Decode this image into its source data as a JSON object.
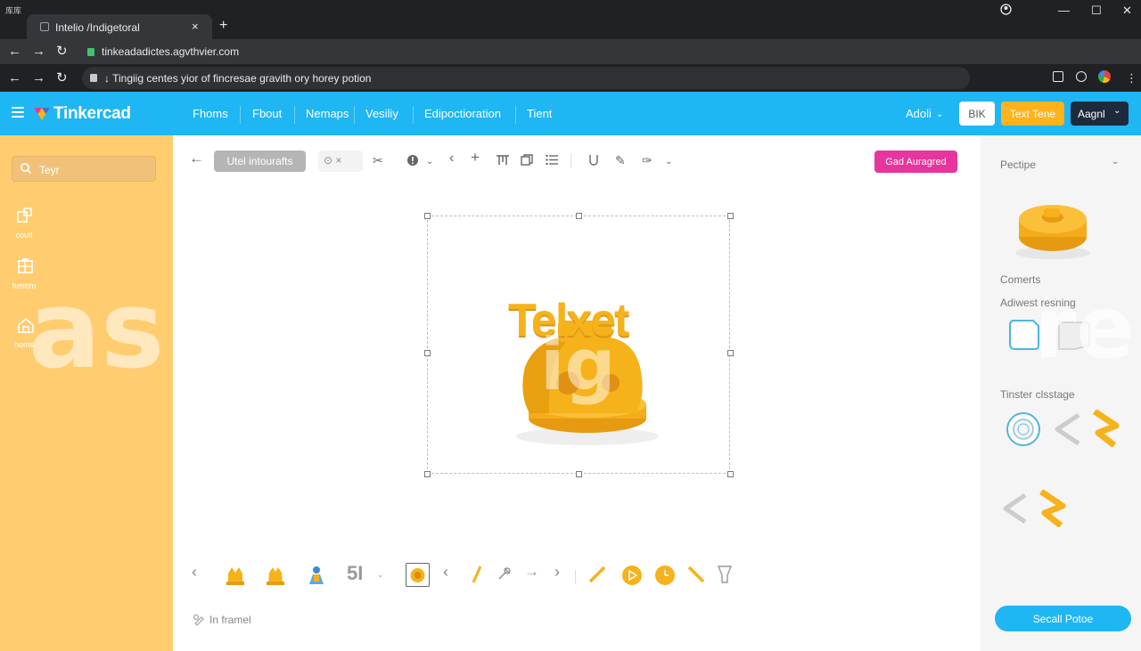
{
  "window": {
    "system_label": "库库",
    "tab_title": "Intelio /Indigetoral",
    "tab_close": "×",
    "new_tab": "+",
    "minimize": "—",
    "maximize": "☐",
    "close": "✕"
  },
  "address_bar": {
    "url": "tinkeadadictes.agvthvier.com"
  },
  "omnibox": {
    "text": "↓ Tingiig centes yior of fincresae gravith ory horey potion"
  },
  "app": {
    "logo": "Tinkercad",
    "menu": [
      "Fhoms",
      "Fbout",
      "Nemaps",
      "Vesiliy",
      "Edipoctioration",
      "Tient"
    ],
    "account": "Adoli",
    "btn_bk": "BIK",
    "btn_teal": "Text Tene",
    "btn_dark": "Aagnl"
  },
  "sidebar_left": {
    "search_placeholder": "Teyr",
    "items": [
      {
        "label": "coutl",
        "icon": "shapes-icon"
      },
      {
        "label": "fusiom",
        "icon": "grid-icon"
      },
      {
        "label": "homs",
        "icon": "home-icon"
      }
    ]
  },
  "toolbar": {
    "chip_label": "Utel intourafts",
    "chip2_label": "⊙ ×",
    "cta_label": "Gad Auragred"
  },
  "canvas": {
    "model_text": "Telxet"
  },
  "status": {
    "label": "In framel"
  },
  "bottom_tools": {
    "size_label": "5I"
  },
  "sidebar_right": {
    "title": "Pectipe",
    "label_comments": "Comerts",
    "label_adwest": "Adiwest resning",
    "label_tinster": "Tinster clsstage",
    "share_button": "Secall Potoe"
  },
  "watermark": {
    "left": "as",
    "mid": "ig",
    "right": "re"
  },
  "colors": {
    "accent": "#1fb6f4",
    "orange_panel": "#ffcd70",
    "pink": "#e6359c",
    "btn_orange": "#ffb21c",
    "btn_dark": "#1d2a3b",
    "model_yellow": "#f6b21a"
  }
}
